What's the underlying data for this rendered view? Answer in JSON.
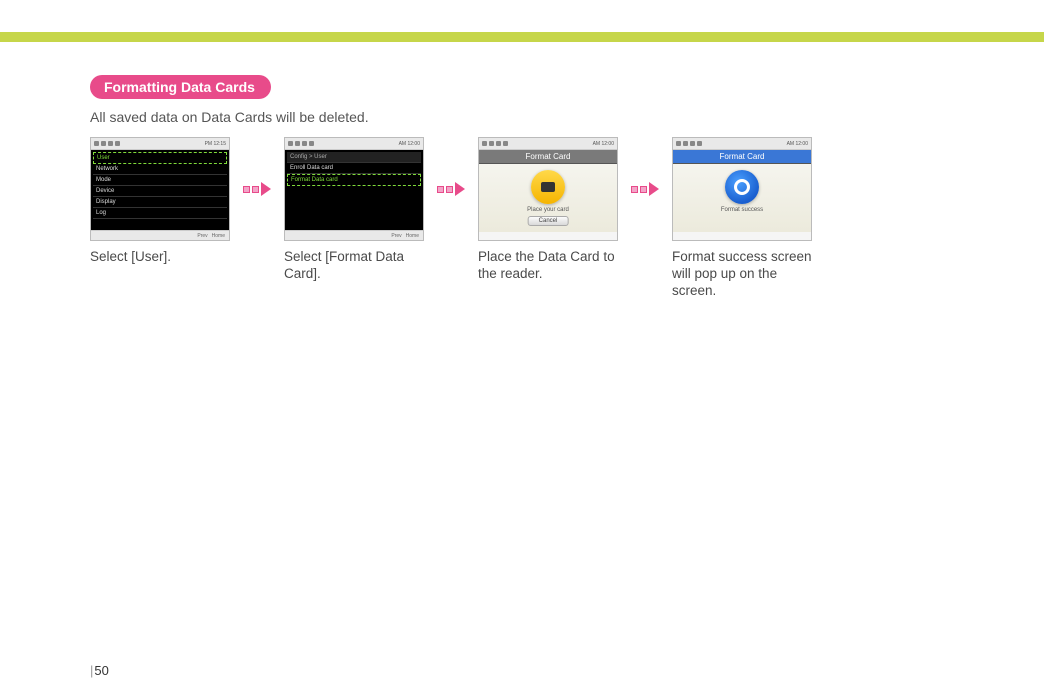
{
  "section": {
    "title": "Formatting Data Cards",
    "description": "All saved data on Data Cards will be deleted."
  },
  "steps": [
    {
      "caption": "Select [User].",
      "thumb": {
        "type": "menu",
        "time": "PM 12:15",
        "items": [
          "User",
          "Network",
          "Mode",
          "Device",
          "Display",
          "Log"
        ],
        "selected_index": 0,
        "footer_left": "Prev",
        "footer_right": "Home"
      }
    },
    {
      "caption": "Select [Format Data Card].",
      "thumb": {
        "type": "menu",
        "time": "AM 12:00",
        "header": "Config > User",
        "items": [
          "Enroll Data card",
          "Format Data card"
        ],
        "selected_index": 1,
        "footer_left": "Prev",
        "footer_right": "Home"
      }
    },
    {
      "caption": "Place the Data Card to the reader.",
      "thumb": {
        "type": "card",
        "time": "AM 12:00",
        "title": "Format Card",
        "title_color": "gray",
        "icon": "yellow",
        "text": "Place your card",
        "button": "Cancel"
      }
    },
    {
      "caption": "Format success screen will pop up on the screen.",
      "thumb": {
        "type": "card",
        "time": "AM 12:00",
        "title": "Format Card",
        "title_color": "blue",
        "icon": "bluecircle",
        "text": "Format success"
      }
    }
  ],
  "page_number": "50"
}
